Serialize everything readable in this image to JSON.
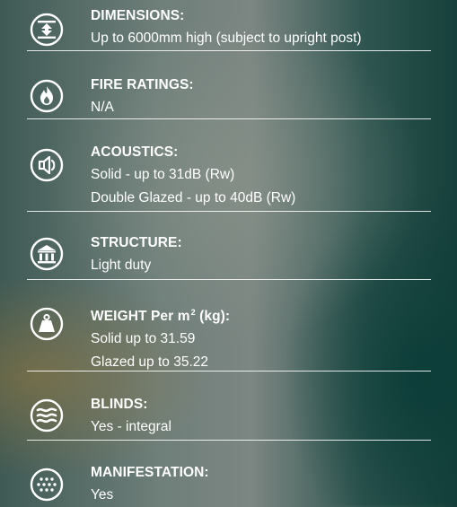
{
  "specs": [
    {
      "icon": "dimensions-icon",
      "title": "DIMENSIONS:",
      "lines": [
        "Up to 6000mm high (subject to upright post)"
      ]
    },
    {
      "icon": "fire-icon",
      "title": "FIRE RATINGS:",
      "lines": [
        "N/A"
      ]
    },
    {
      "icon": "speaker-icon",
      "title": "ACOUSTICS:",
      "lines": [
        "Solid - up to 31dB (Rw)",
        "Double Glazed - up to 40dB (Rw)"
      ]
    },
    {
      "icon": "building-icon",
      "title": "STRUCTURE:",
      "lines": [
        "Light duty"
      ]
    },
    {
      "icon": "weight-icon",
      "title_pre": "WEIGHT Per m",
      "title_sup": "2",
      "title_post": " (kg):",
      "lines": [
        "Solid up to 31.59",
        "Glazed up to 35.22"
      ]
    },
    {
      "icon": "blinds-icon",
      "title": "BLINDS:",
      "lines": [
        "Yes - integral"
      ]
    },
    {
      "icon": "manifestation-icon",
      "title": "MANIFESTATION:",
      "lines": [
        "Yes"
      ]
    }
  ]
}
